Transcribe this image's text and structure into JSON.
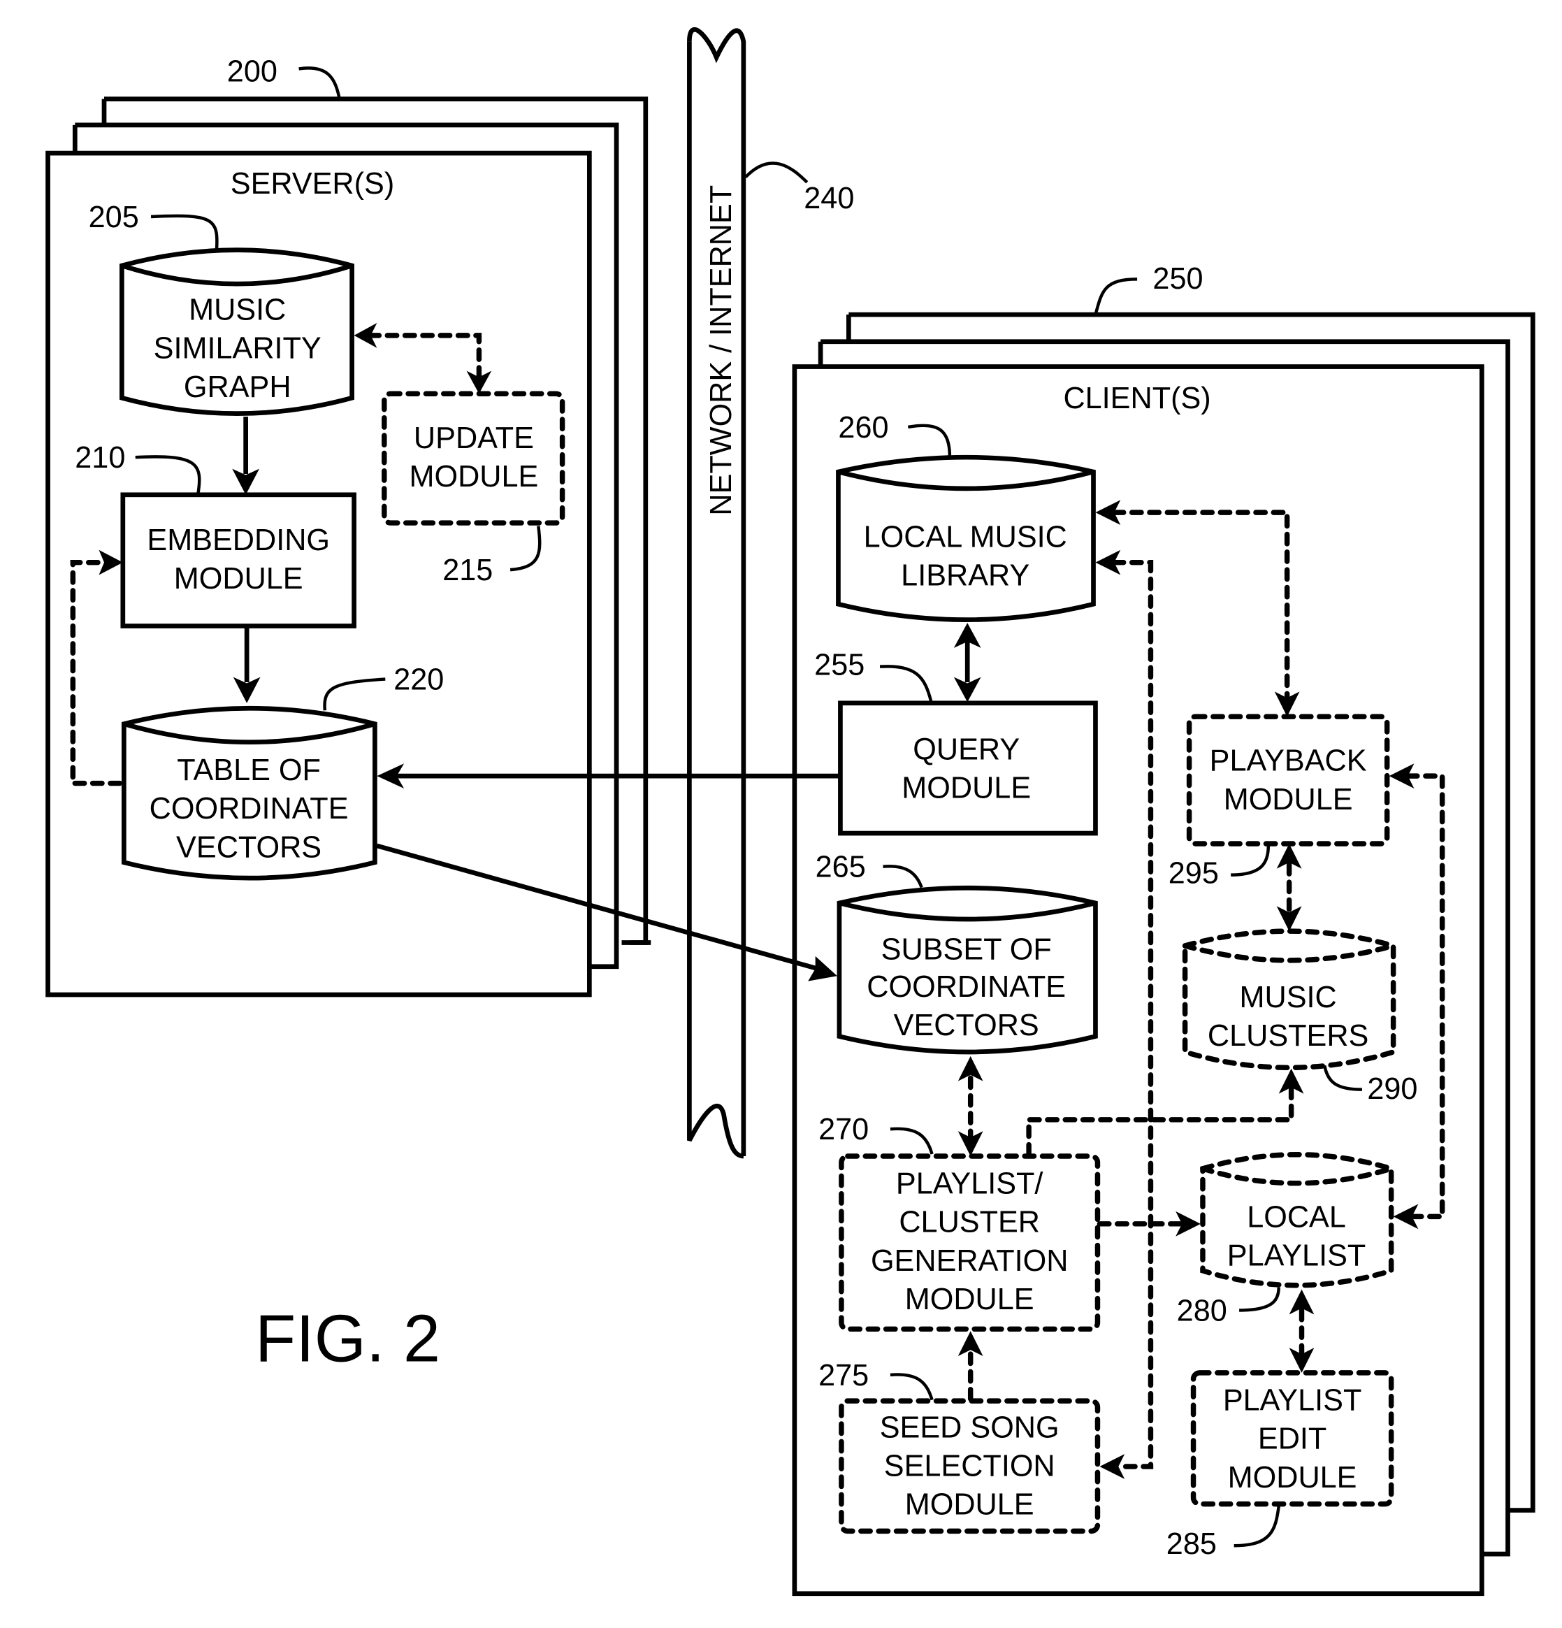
{
  "figure": {
    "caption": "FIG. 2",
    "network": {
      "label": "NETWORK / INTERNET",
      "ref": "240"
    },
    "server": {
      "title": "SERVER(S)",
      "ref": "200",
      "components": {
        "similarity_graph": {
          "lines": [
            "MUSIC",
            "SIMILARITY",
            "GRAPH"
          ],
          "ref": "205",
          "shape": "database"
        },
        "embedding_module": {
          "lines": [
            "EMBEDDING",
            "MODULE"
          ],
          "ref": "210",
          "shape": "box"
        },
        "update_module": {
          "lines": [
            "UPDATE",
            "MODULE"
          ],
          "ref": "215",
          "shape": "dashed-box"
        },
        "coordinate_table": {
          "lines": [
            "TABLE OF",
            "COORDINATE",
            "VECTORS"
          ],
          "ref": "220",
          "shape": "database"
        }
      }
    },
    "client": {
      "title": "CLIENT(S)",
      "ref": "250",
      "components": {
        "local_music_library": {
          "lines": [
            "LOCAL MUSIC",
            "LIBRARY"
          ],
          "ref": "260",
          "shape": "database"
        },
        "query_module": {
          "lines": [
            "QUERY",
            "MODULE"
          ],
          "ref": "255",
          "shape": "box"
        },
        "subset_vectors": {
          "lines": [
            "SUBSET OF",
            "COORDINATE",
            "VECTORS"
          ],
          "ref": "265",
          "shape": "database"
        },
        "playlist_cluster_generation": {
          "lines": [
            "PLAYLIST/",
            "CLUSTER",
            "GENERATION",
            "MODULE"
          ],
          "ref": "270",
          "shape": "dashed-box"
        },
        "seed_song_selection": {
          "lines": [
            "SEED SONG",
            "SELECTION",
            "MODULE"
          ],
          "ref": "275",
          "shape": "dashed-box"
        },
        "playback_module": {
          "lines": [
            "PLAYBACK",
            "MODULE"
          ],
          "ref": "295",
          "shape": "dashed-box"
        },
        "music_clusters": {
          "lines": [
            "MUSIC",
            "CLUSTERS"
          ],
          "ref": "290",
          "shape": "dashed-database"
        },
        "local_playlist": {
          "lines": [
            "LOCAL",
            "PLAYLIST"
          ],
          "ref": "280",
          "shape": "dashed-database"
        },
        "playlist_edit": {
          "lines": [
            "PLAYLIST",
            "EDIT",
            "MODULE"
          ],
          "ref": "285",
          "shape": "dashed-box"
        }
      }
    }
  }
}
